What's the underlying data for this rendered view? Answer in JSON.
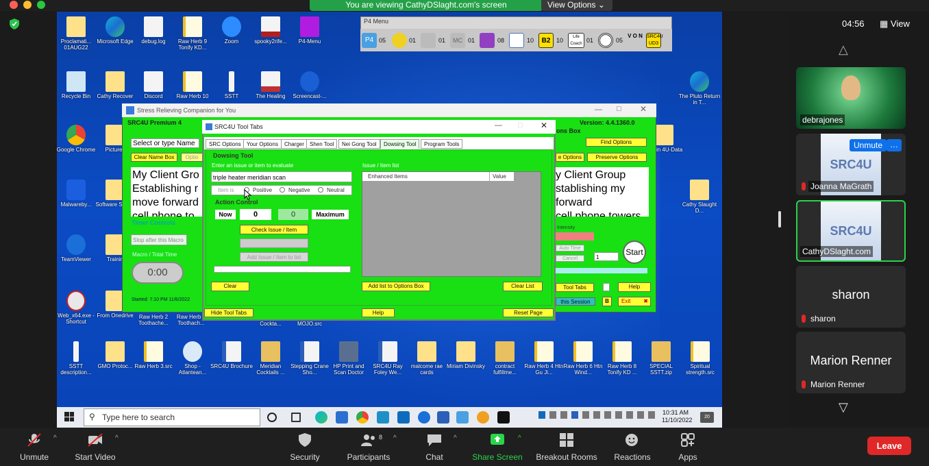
{
  "zoom": {
    "banner": "You are viewing CathyDSlaght.com's screen",
    "view_options": "View Options",
    "timer": "04:56",
    "view_label": "View"
  },
  "participants": [
    {
      "name": "debrajones"
    },
    {
      "name": "Joanna MaGrath",
      "unmute_label": "Unmute",
      "more_label": "…"
    },
    {
      "name": "CathyDSlaght.com"
    },
    {
      "name": "sharon",
      "label": "sharon"
    },
    {
      "name": "Marion Renner",
      "label": "Marion Renner"
    }
  ],
  "toolbar": {
    "unmute": "Unmute",
    "start_video": "Start Video",
    "security": "Security",
    "participants": "Participants",
    "participants_count": "8",
    "chat": "Chat",
    "share_screen": "Share Screen",
    "breakout_rooms": "Breakout Rooms",
    "reactions": "Reactions",
    "apps": "Apps",
    "leave": "Leave"
  },
  "desktop_icons": [
    {
      "label": "Proclamati... 01AUG22"
    },
    {
      "label": "Microsoft Edge"
    },
    {
      "label": "debug.log"
    },
    {
      "label": "Raw Herb 9 Tonify KD..."
    },
    {
      "label": "Zoom"
    },
    {
      "label": "spooky2rife..."
    },
    {
      "label": "P4-Menu"
    },
    {
      "label": "Recycle Bin"
    },
    {
      "label": "Cathy Recover"
    },
    {
      "label": "Discord"
    },
    {
      "label": "Raw Herb 10"
    },
    {
      "label": "SSTT"
    },
    {
      "label": "The Healing"
    },
    {
      "label": "Screencast-..."
    },
    {
      "label": "The Pluto Return in T..."
    },
    {
      "label": "Google Chrome"
    },
    {
      "label": "Pictures"
    },
    {
      "label": "ALL in 4U-Data"
    },
    {
      "label": "Malwareby..."
    },
    {
      "label": "Software Suppo"
    },
    {
      "label": "Cathy Slaught D..."
    },
    {
      "label": "TeamViewer"
    },
    {
      "label": "Trainin"
    },
    {
      "label": "Web_x64.exe - Shortcut"
    },
    {
      "label": "From Onedrive"
    },
    {
      "label": "Raw Herb 2 Toothache..."
    },
    {
      "label": "Raw Herb 1 Toothach..."
    },
    {
      "label": "Cockta..."
    },
    {
      "label": "MOJO.src"
    },
    {
      "label": "SSTT description..."
    },
    {
      "label": "GMO Protoc..."
    },
    {
      "label": "Raw Herb 3.src"
    },
    {
      "label": "Shop - Atlantean..."
    },
    {
      "label": "SRC4U Brochure"
    },
    {
      "label": "Meridian Cocktails ..."
    },
    {
      "label": "Stepping Crane Sho..."
    },
    {
      "label": "HP Print and Scan Doctor"
    },
    {
      "label": "SRC4U Ray Foley We..."
    },
    {
      "label": "malcome rae cards"
    },
    {
      "label": "Miriam Divinsky"
    },
    {
      "label": "contract fulfillme..."
    },
    {
      "label": "Raw Herb 4 Htn Gu Ji..."
    },
    {
      "label": "Raw Herb 6 Htn Wind..."
    },
    {
      "label": "Raw Herb 8 Tonify KD ..."
    },
    {
      "label": "SPECIAL SSTT.zip"
    },
    {
      "label": "Spiritual strength.src"
    }
  ],
  "taskbar": {
    "search_placeholder": "Type here to search",
    "time": "10:31 AM",
    "date": "11/10/2022",
    "notif_count": "20"
  },
  "p4menu": {
    "title": "P4 Menu",
    "nums": [
      "05",
      "01",
      "01",
      "01",
      "08",
      "10",
      "10",
      "01",
      "05"
    ],
    "b2_label": "B2",
    "life_coach": "Life Coach",
    "von": "V O N",
    "src4u": "SRC4U UD3"
  },
  "src_window": {
    "title": "Stress Relieving Companion for You",
    "premium": "SRC4U Premium 4",
    "version": "Version: 4.4.1360.0",
    "options_box_label": "ons Box",
    "name_box": "Select or type Name",
    "clear_name_box": "Clear Name Box",
    "options_short": "Optio",
    "find_options": "Find Options",
    "e_options": "e Options",
    "preserve_options": "Preserve Options",
    "left_text": [
      "My Client Gro",
      "Establishing r",
      "move forward",
      "cell phone to"
    ],
    "right_text": [
      "y Client Group",
      "stablishing my",
      "forward",
      "cell phone towers"
    ],
    "timer_controls": "Timer Controls",
    "stop_after_macro": "Stop after this Macro",
    "macro_total_time": "Macro / Total Time",
    "timer_value": "0:00",
    "started": "Started: 7:10 PM 11/6/2022",
    "intensity_label": "Intensity",
    "auto_time": "Auto Time",
    "cancel": "Cancel",
    "count_value": "1",
    "start": "Start",
    "tool_tabs": "Tool Tabs",
    "help": "Help",
    "this_session": "this Session",
    "b": "B",
    "exit": "Exit"
  },
  "tool_window": {
    "title": "SRC4U Tool Tabs",
    "tabs": [
      "SRC Options",
      "Your Options",
      "Charger",
      "Shen Tool",
      "Nei Gong Tool",
      "Dowsing Tool",
      "Program Tools"
    ],
    "section": "Dowsing Tool",
    "enter_issue": "Enter an issue or item to evaluate",
    "issue_value": "triple heater meridian scan",
    "item_is": "Item is",
    "positive": "Positive",
    "negative": "Negative",
    "neutral": "Neutral",
    "action_control": "Action Control",
    "now": "Now",
    "now_value": "0",
    "max_value": "0",
    "maximum": "Maximum",
    "check_issue": "Check Issue / Item",
    "add_issue": "Add Issue / Item to list",
    "clear": "Clear",
    "issue_list": "Issue / Item list",
    "col_items": "Enhanced Items",
    "col_value": "Value",
    "add_list_to_options": "Add list to Options Box",
    "clear_list": "Clear List",
    "hide_tool_tabs": "Hide Tool Tabs",
    "help": "Help",
    "reset_page": "Reset Page"
  }
}
